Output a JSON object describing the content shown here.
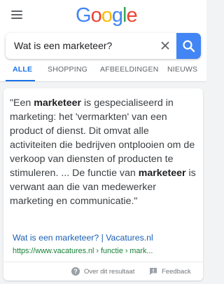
{
  "logo": {
    "text": "Google",
    "letters": [
      "G",
      "o",
      "o",
      "g",
      "l",
      "e"
    ]
  },
  "colors": {
    "blue": "#4285f4",
    "red": "#ea4335",
    "yellow": "#fbbc05",
    "green": "#34a853",
    "accent": "#1a73e8"
  },
  "search": {
    "query": "Wat is een marketeer?"
  },
  "tabs": [
    {
      "label": "ALLE"
    },
    {
      "label": "SHOPPING"
    },
    {
      "label": "AFBEELDINGEN"
    },
    {
      "label": "NIEUWS"
    }
  ],
  "result": {
    "snippet": {
      "open_quote": "\"Een ",
      "bold_1": "marketeer",
      "mid": " is gespecialiseerd in marketing: het 'vermarkten' van een product of dienst. Dit omvat alle activiteiten die bedrijven ontplooien om de verkoop van diensten of producten te stimuleren. ... De functie van ",
      "bold_2": "marketeer",
      "end": " is verwant aan die van medewerker marketing en communicatie.\""
    },
    "title": "Wat is een marketeer? | Vacatures.nl",
    "url": "https://www.vacatures.nl › functie › mark..."
  },
  "footer": {
    "about": "Over dit resultaat",
    "feedback": "Feedback"
  }
}
